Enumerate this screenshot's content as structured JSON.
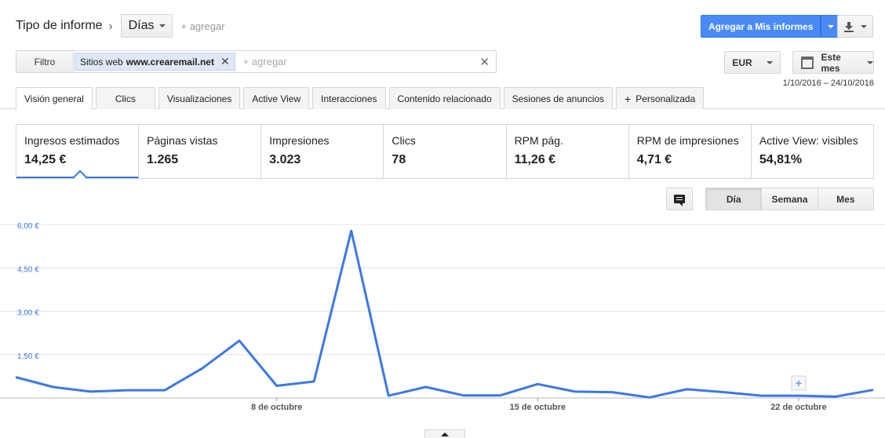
{
  "report_type": {
    "label": "Tipo de informe",
    "selected": "Días",
    "add": "+ agregar"
  },
  "actions": {
    "add_to_reports": "Agregar a Mis informes",
    "download_icon": "download-icon"
  },
  "filter": {
    "button": "Filtro",
    "chip_prefix": "Sitios web",
    "chip_value": "www.crearemail.net",
    "placeholder": "+ agregar"
  },
  "currency": "EUR",
  "period": {
    "label": "Este mes",
    "range": "1/10/2016 – 24/10/2016"
  },
  "tabs": [
    {
      "label": "Visión general"
    },
    {
      "label": "Clics"
    },
    {
      "label": "Visualizaciones"
    },
    {
      "label": "Active View"
    },
    {
      "label": "Interacciones"
    },
    {
      "label": "Contenido relacionado"
    },
    {
      "label": "Sesiones de anuncios"
    },
    {
      "label": "Personalizada"
    }
  ],
  "metrics": [
    {
      "label": "Ingresos estimados",
      "value": "14,25 €"
    },
    {
      "label": "Páginas vistas",
      "value": "1.265"
    },
    {
      "label": "Impresiones",
      "value": "3.023"
    },
    {
      "label": "Clics",
      "value": "78"
    },
    {
      "label": "RPM pág.",
      "value": "11,26 €"
    },
    {
      "label": "RPM de impresiones",
      "value": "4,71 €"
    },
    {
      "label": "Active View: visibles",
      "value": "54,81%"
    }
  ],
  "granularity": {
    "day": "Día",
    "week": "Semana",
    "month": "Mes"
  },
  "colors": {
    "accent": "#4a8af4",
    "line": "#3b78e7"
  },
  "chart_data": {
    "type": "line",
    "x": [
      "1 oct",
      "2 oct",
      "3 oct",
      "4 oct",
      "5 oct",
      "6 oct",
      "7 oct",
      "8 oct",
      "9 oct",
      "10 oct",
      "11 oct",
      "12 oct",
      "13 oct",
      "14 oct",
      "15 oct",
      "16 oct",
      "17 oct",
      "18 oct",
      "19 oct",
      "20 oct",
      "21 oct",
      "22 oct",
      "23 oct",
      "24 oct"
    ],
    "series": [
      {
        "values": [
          0.72,
          0.38,
          0.22,
          0.27,
          0.27,
          1.02,
          1.98,
          0.42,
          0.57,
          5.78,
          0.08,
          0.38,
          0.09,
          0.09,
          0.48,
          0.22,
          0.2,
          0.02,
          0.3,
          0.2,
          0.08,
          0.08,
          0.05,
          0.28
        ]
      }
    ],
    "ylim": [
      0,
      6.0
    ],
    "yticks": [
      "6,00 €",
      "4,50 €",
      "3,00 €",
      "1,50 €"
    ],
    "ytick_values": [
      6.0,
      4.5,
      3.0,
      1.5
    ],
    "xticks": [
      "8 de octubre",
      "15 de octubre",
      "22 de octubre"
    ],
    "xtick_indices": [
      7,
      14,
      21
    ],
    "grid": true
  }
}
